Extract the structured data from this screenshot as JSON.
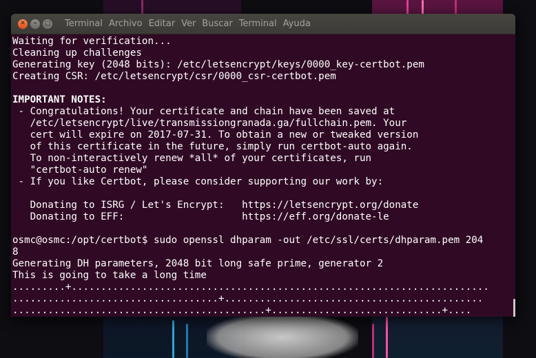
{
  "menubar": {
    "items": [
      "Terminal",
      "Archivo",
      "Editar",
      "Ver",
      "Buscar",
      "Terminal",
      "Ayuda"
    ]
  },
  "window_controls": {
    "close": "✕",
    "minimize": "–",
    "maximize": "□"
  },
  "terminal": {
    "lines": [
      "Waiting for verification...",
      "Cleaning up challenges",
      "Generating key (2048 bits): /etc/letsencrypt/keys/0000_key-certbot.pem",
      "Creating CSR: /etc/letsencrypt/csr/0000_csr-certbot.pem",
      "",
      "IMPORTANT NOTES:",
      " - Congratulations! Your certificate and chain have been saved at",
      "   /etc/letsencrypt/live/transmissiongranada.ga/fullchain.pem. Your",
      "   cert will expire on 2017-07-31. To obtain a new or tweaked version",
      "   of this certificate in the future, simply run certbot-auto again.",
      "   To non-interactively renew *all* of your certificates, run",
      "   \"certbot-auto renew\"",
      " - If you like Certbot, please consider supporting our work by:",
      "",
      "   Donating to ISRG / Let's Encrypt:   https://letsencrypt.org/donate",
      "   Donating to EFF:                    https://eff.org/donate-le",
      "",
      "osmc@osmc:/opt/certbot$ sudo openssl dhparam -out /etc/ssl/certs/dhparam.pem 204",
      "8",
      "Generating DH parameters, 2048 bit long safe prime, generator 2",
      "This is going to take a long time",
      ".........+.......................................................................",
      "...................................+............................................",
      "...........................................+.............................+...."
    ]
  },
  "colors": {
    "terminal_bg": "#300a24",
    "terminal_fg": "#ffffff",
    "titlebar": "#3c3b37",
    "close_button": "#df4b16"
  }
}
